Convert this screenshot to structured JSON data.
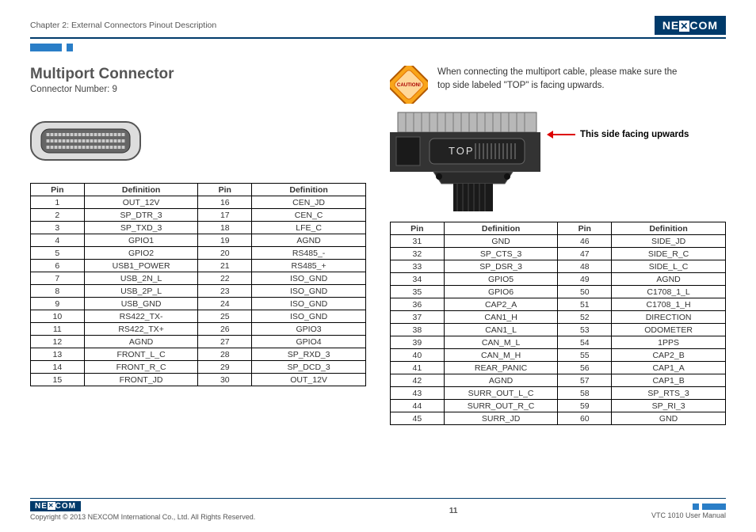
{
  "header": {
    "chapter": "Chapter 2: External Connectors Pinout Description",
    "brand": "NEXCOM"
  },
  "section": {
    "title": "Multiport Connector",
    "connector_number": "Connector Number: 9"
  },
  "warning": {
    "badge": "CAUTION!",
    "text_l1": "When connecting the multiport cable, please make sure the",
    "text_l2": "top side labeled \"TOP\" is facing upwards."
  },
  "photo": {
    "top_label": "TOP",
    "arrow_label": "This side facing upwards"
  },
  "table_headers": {
    "pin": "Pin",
    "def": "Definition"
  },
  "table_left": [
    {
      "p1": "1",
      "d1": "OUT_12V",
      "p2": "16",
      "d2": "CEN_JD"
    },
    {
      "p1": "2",
      "d1": "SP_DTR_3",
      "p2": "17",
      "d2": "CEN_C"
    },
    {
      "p1": "3",
      "d1": "SP_TXD_3",
      "p2": "18",
      "d2": "LFE_C"
    },
    {
      "p1": "4",
      "d1": "GPIO1",
      "p2": "19",
      "d2": "AGND"
    },
    {
      "p1": "5",
      "d1": "GPIO2",
      "p2": "20",
      "d2": "RS485_-"
    },
    {
      "p1": "6",
      "d1": "USB1_POWER",
      "p2": "21",
      "d2": "RS485_+"
    },
    {
      "p1": "7",
      "d1": "USB_2N_L",
      "p2": "22",
      "d2": "ISO_GND"
    },
    {
      "p1": "8",
      "d1": "USB_2P_L",
      "p2": "23",
      "d2": "ISO_GND"
    },
    {
      "p1": "9",
      "d1": "USB_GND",
      "p2": "24",
      "d2": "ISO_GND"
    },
    {
      "p1": "10",
      "d1": "RS422_TX-",
      "p2": "25",
      "d2": "ISO_GND"
    },
    {
      "p1": "11",
      "d1": "RS422_TX+",
      "p2": "26",
      "d2": "GPIO3"
    },
    {
      "p1": "12",
      "d1": "AGND",
      "p2": "27",
      "d2": "GPIO4"
    },
    {
      "p1": "13",
      "d1": "FRONT_L_C",
      "p2": "28",
      "d2": "SP_RXD_3"
    },
    {
      "p1": "14",
      "d1": "FRONT_R_C",
      "p2": "29",
      "d2": "SP_DCD_3"
    },
    {
      "p1": "15",
      "d1": "FRONT_JD",
      "p2": "30",
      "d2": "OUT_12V"
    }
  ],
  "table_right": [
    {
      "p1": "31",
      "d1": "GND",
      "p2": "46",
      "d2": "SIDE_JD"
    },
    {
      "p1": "32",
      "d1": "SP_CTS_3",
      "p2": "47",
      "d2": "SIDE_R_C"
    },
    {
      "p1": "33",
      "d1": "SP_DSR_3",
      "p2": "48",
      "d2": "SIDE_L_C"
    },
    {
      "p1": "34",
      "d1": "GPIO5",
      "p2": "49",
      "d2": "AGND"
    },
    {
      "p1": "35",
      "d1": "GPIO6",
      "p2": "50",
      "d2": "C1708_1_L"
    },
    {
      "p1": "36",
      "d1": "CAP2_A",
      "p2": "51",
      "d2": "C1708_1_H"
    },
    {
      "p1": "37",
      "d1": "CAN1_H",
      "p2": "52",
      "d2": "DIRECTION"
    },
    {
      "p1": "38",
      "d1": "CAN1_L",
      "p2": "53",
      "d2": "ODOMETER"
    },
    {
      "p1": "39",
      "d1": "CAN_M_L",
      "p2": "54",
      "d2": "1PPS"
    },
    {
      "p1": "40",
      "d1": "CAN_M_H",
      "p2": "55",
      "d2": "CAP2_B"
    },
    {
      "p1": "41",
      "d1": "REAR_PANIC",
      "p2": "56",
      "d2": "CAP1_A"
    },
    {
      "p1": "42",
      "d1": "AGND",
      "p2": "57",
      "d2": "CAP1_B"
    },
    {
      "p1": "43",
      "d1": "SURR_OUT_L_C",
      "p2": "58",
      "d2": "SP_RTS_3"
    },
    {
      "p1": "44",
      "d1": "SURR_OUT_R_C",
      "p2": "59",
      "d2": "SP_RI_3"
    },
    {
      "p1": "45",
      "d1": "SURR_JD",
      "p2": "60",
      "d2": "GND"
    }
  ],
  "footer": {
    "copyright": "Copyright © 2013 NEXCOM International Co., Ltd. All Rights Reserved.",
    "page": "11",
    "manual": "VTC 1010 User Manual"
  }
}
